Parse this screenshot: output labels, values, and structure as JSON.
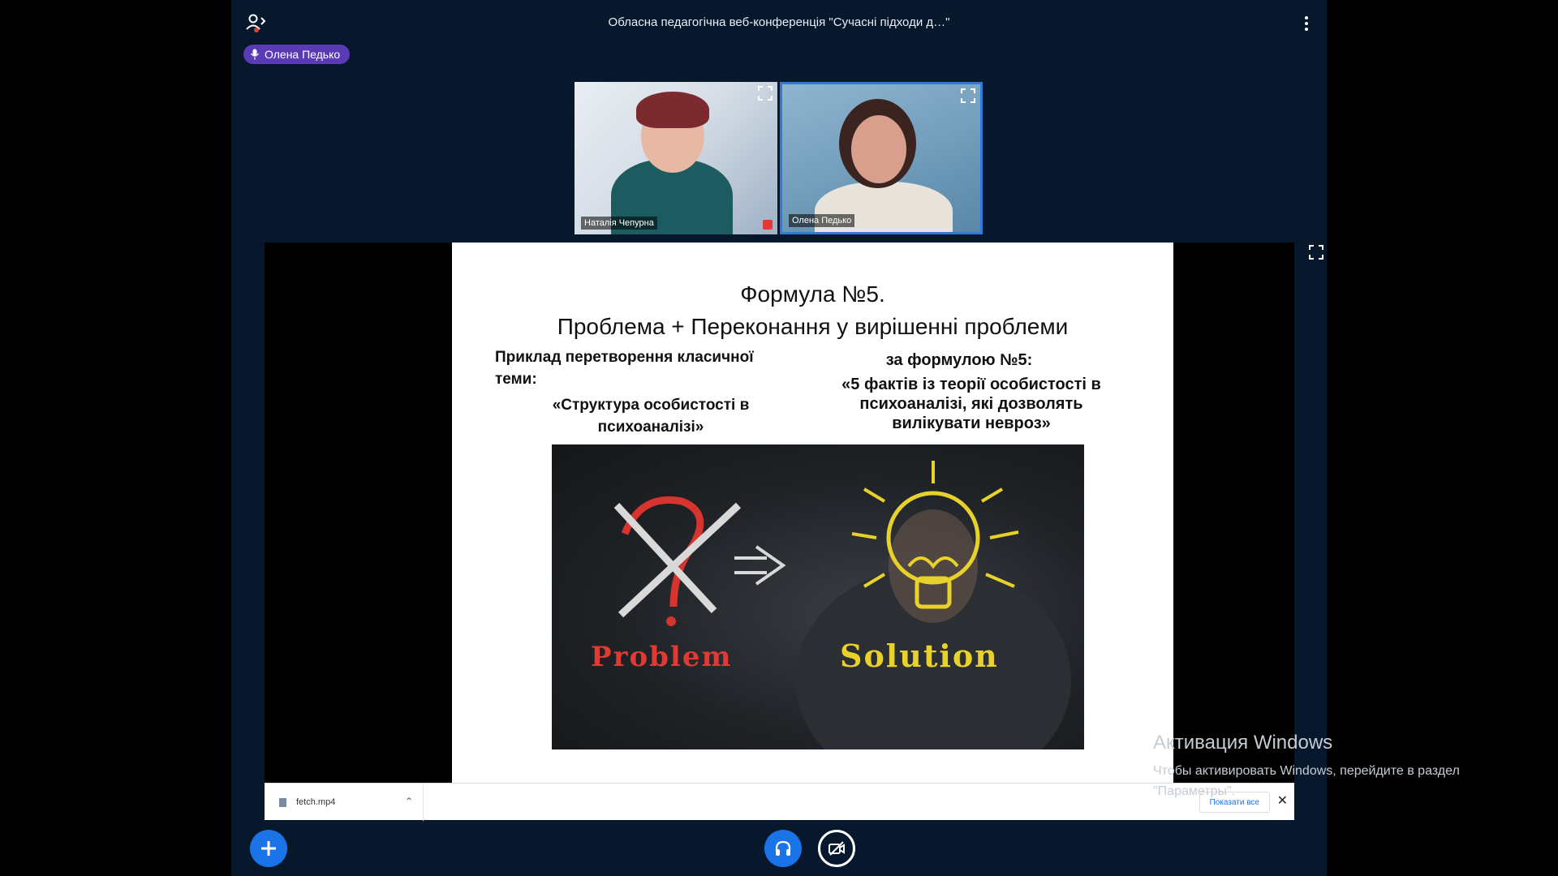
{
  "header": {
    "title": "Обласна педагогічна веб-конференція \"Сучасні підходи д…\""
  },
  "talking": {
    "name": "Олена Педько"
  },
  "videos": [
    {
      "name": "Наталія Чепурна"
    },
    {
      "name": "Олена Педько"
    }
  ],
  "slide": {
    "title": "Формула №5.",
    "subtitle": "Проблема + Переконання у вирішенні проблеми",
    "left_head": "Приклад перетворення класичної теми:",
    "left_quote": "«Структура особистості в психоаналізі»",
    "right_head": "за формулою №5:",
    "right_quote": "«5 фактів із теорії особистості в психоаналізі, які дозволять вилікувати невроз»",
    "image_word_left": "Problem",
    "image_word_right": "Solution"
  },
  "download_bar": {
    "file_name": "fetch.mp4",
    "show_all": "Показати все"
  },
  "windows_activation": {
    "title": "Активация Windows",
    "line1": "Чтобы активировать Windows, перейдите в раздел",
    "line2": "\"Параметры\"."
  },
  "colors": {
    "app_bg": "#07182c",
    "accent": "#1b73e8",
    "talker_badge": "#5b3bb5"
  },
  "icons": {
    "users": "users-icon",
    "menu": "kebab-icon",
    "mic": "mic-icon",
    "fullscreen": "fullscreen-icon",
    "plus": "plus-icon",
    "headphones": "headphones-icon",
    "camera_off": "camera-off-icon"
  }
}
